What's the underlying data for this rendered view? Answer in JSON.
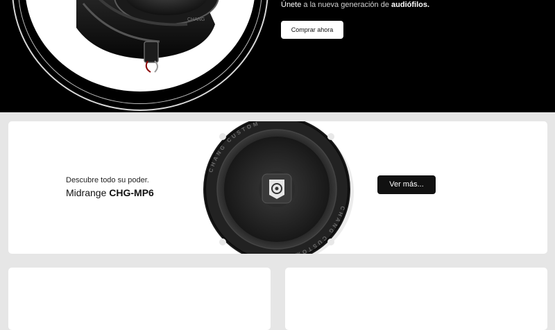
{
  "hero": {
    "tagline_lead": "Únete",
    "tagline_middle": " a la nueva generación de ",
    "tagline_bold": "audiófilos.",
    "buy_button_label": "Comprar ahora"
  },
  "product": {
    "subtitle": "Descubre todo su poder.",
    "title_prefix": "Midrange ",
    "title_model": "CHG-MP6",
    "more_button_label": "Ver más...",
    "brand_ring_text": "CHANG CUSTOM"
  },
  "colors": {
    "hero_bg": "#000000",
    "page_bg": "#e6e6e6",
    "card_bg": "#ffffff",
    "button_dark": "#111111"
  }
}
